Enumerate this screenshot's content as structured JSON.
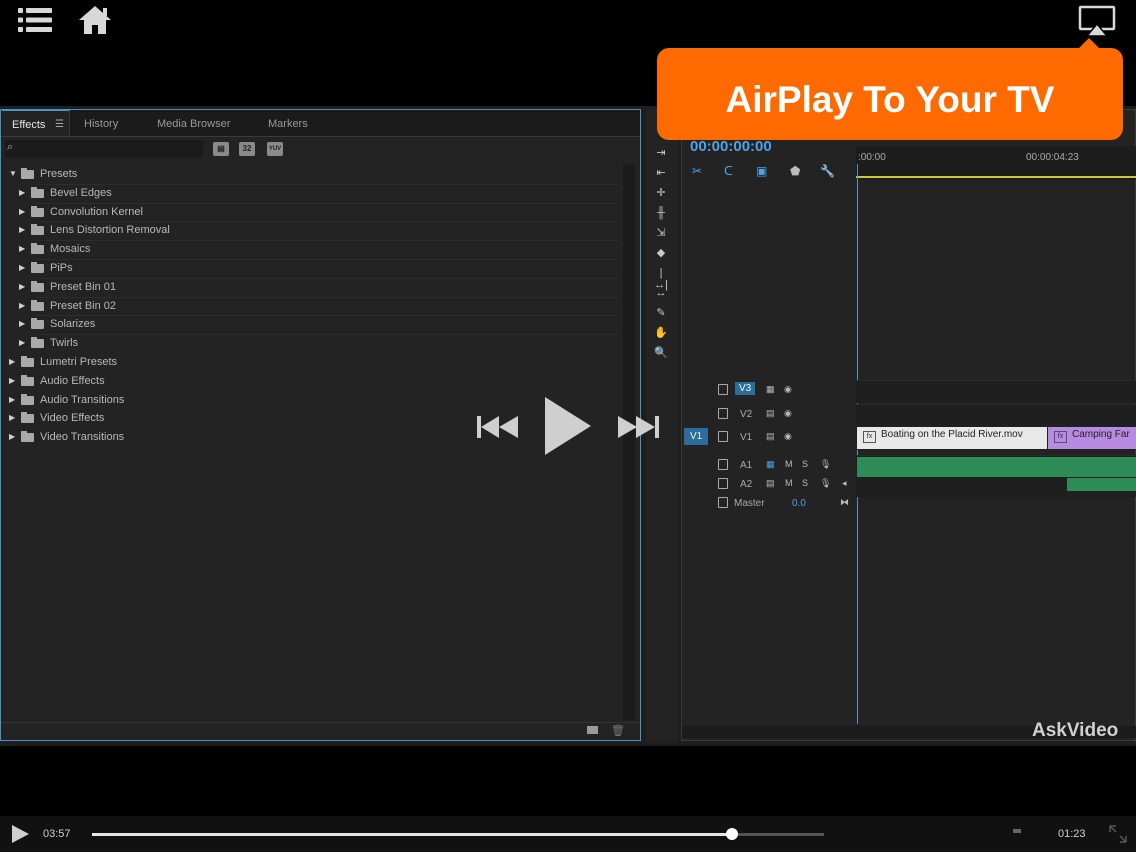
{
  "player": {
    "elapsed": "03:57",
    "remaining": "01:23",
    "progress_fraction": 0.94,
    "airplay_callout": "AirPlay To Your TV"
  },
  "effects_panel": {
    "tabs": [
      {
        "label": "Effects"
      },
      {
        "label": "History"
      },
      {
        "label": "Media Browser"
      },
      {
        "label": "Markers"
      }
    ],
    "toolbar_badges": [
      "32",
      "YUV"
    ],
    "tree": [
      {
        "label": "Presets",
        "level": 0,
        "expanded": true,
        "preset_folder": true
      },
      {
        "label": "Bevel Edges",
        "level": 1,
        "preset_folder": true
      },
      {
        "label": "Convolution Kernel",
        "level": 1,
        "preset_folder": true
      },
      {
        "label": "Lens Distortion Removal",
        "level": 1,
        "preset_folder": true
      },
      {
        "label": "Mosaics",
        "level": 1,
        "preset_folder": true
      },
      {
        "label": "PiPs",
        "level": 1,
        "preset_folder": true
      },
      {
        "label": "Preset Bin 01",
        "level": 1,
        "preset_folder": true
      },
      {
        "label": "Preset Bin 02",
        "level": 1,
        "preset_folder": true
      },
      {
        "label": "Solarizes",
        "level": 1,
        "preset_folder": true
      },
      {
        "label": "Twirls",
        "level": 1,
        "preset_folder": true
      },
      {
        "label": "Lumetri Presets",
        "level": 0,
        "preset_folder": true
      },
      {
        "label": "Audio Effects",
        "level": 0
      },
      {
        "label": "Audio Transitions",
        "level": 0
      },
      {
        "label": "Video Effects",
        "level": 0
      },
      {
        "label": "Video Transitions",
        "level": 0
      }
    ]
  },
  "timeline": {
    "timecode": "00:00:00:00",
    "ruler_start": ":00:00",
    "ruler_mark": "00:00:04:23",
    "tracks": [
      {
        "name": "V3",
        "source": ""
      },
      {
        "name": "V2",
        "source": ""
      },
      {
        "name": "V1",
        "source": "V1"
      },
      {
        "name": "A1"
      },
      {
        "name": "A2"
      }
    ],
    "audio_flags": [
      "M",
      "S"
    ],
    "master": {
      "label": "Master",
      "value": "0.0"
    },
    "clips": [
      "Boating on the Placid River.mov",
      "Camping Far"
    ]
  },
  "watermark": "AskVideo",
  "colors": {
    "callout": "#ff6a00",
    "timecode": "#4da3e6",
    "clip_video": "#e8e8e8",
    "clip_purple": "#b88be3",
    "audio": "#2e8d57"
  }
}
